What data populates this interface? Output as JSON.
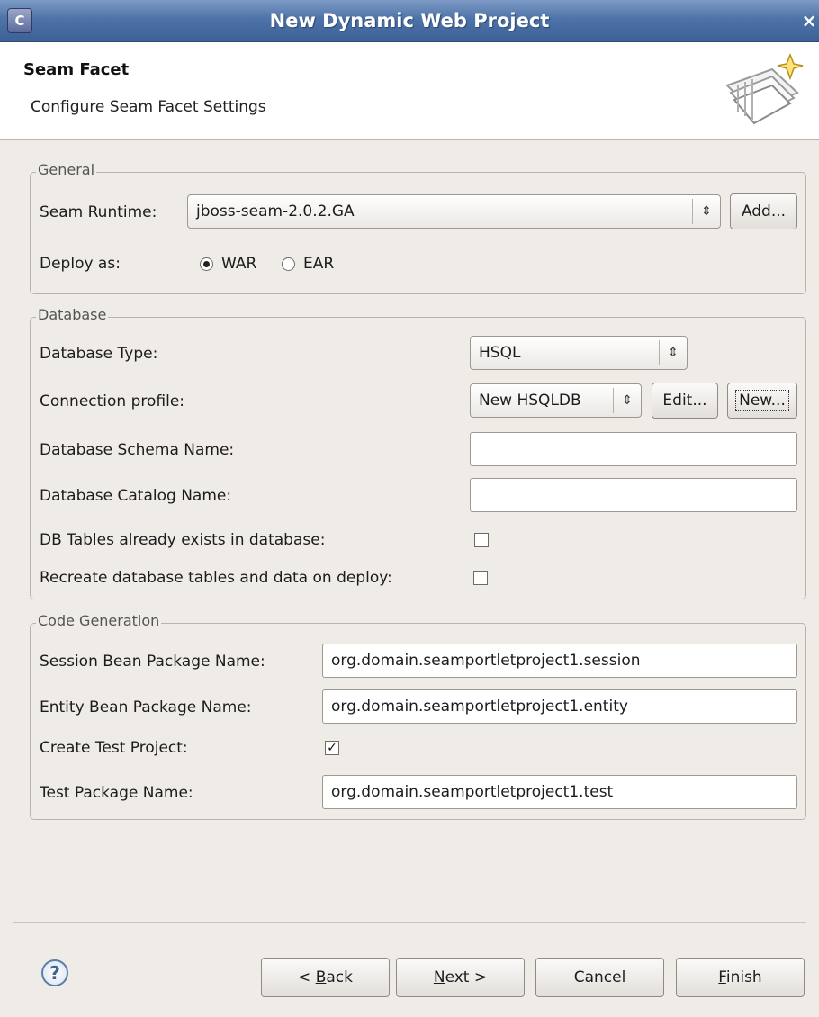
{
  "window": {
    "title": "New Dynamic Web Project",
    "close_glyph": "×",
    "app_icon_letter": "C"
  },
  "header": {
    "title": "Seam Facet",
    "description": "Configure Seam Facet Settings"
  },
  "general": {
    "legend": "General",
    "seam_runtime_label": "Seam Runtime:",
    "seam_runtime_value": "jboss-seam-2.0.2.GA",
    "add_button": "Add...",
    "deploy_as_label": "Deploy as:",
    "deploy_options": [
      {
        "label": "WAR",
        "selected": true
      },
      {
        "label": "EAR",
        "selected": false
      }
    ]
  },
  "database": {
    "legend": "Database",
    "type_label": "Database Type:",
    "type_value": "HSQL",
    "connection_label": "Connection profile:",
    "connection_value": "New HSQLDB",
    "edit_button": "Edit...",
    "new_button": "New...",
    "schema_label": "Database Schema Name:",
    "schema_value": "",
    "catalog_label": "Database Catalog Name:",
    "catalog_value": "",
    "tables_exist_label": "DB Tables already exists in database:",
    "tables_exist_checked": false,
    "recreate_label": "Recreate database tables and data on deploy:",
    "recreate_checked": false
  },
  "code_generation": {
    "legend": "Code Generation",
    "session_label": "Session Bean Package Name:",
    "session_value": "org.domain.seamportletproject1.session",
    "entity_label": "Entity Bean Package Name:",
    "entity_value": "org.domain.seamportletproject1.entity",
    "create_test_label": "Create Test Project:",
    "create_test_checked": true,
    "test_package_label": "Test Package Name:",
    "test_package_value": "org.domain.seamportletproject1.test"
  },
  "footer": {
    "help_glyph": "?",
    "back_prefix": "< ",
    "back_mnemonic": "B",
    "back_rest": "ack",
    "next_mnemonic": "N",
    "next_rest": "ext >",
    "cancel": "Cancel",
    "finish_mnemonic": "F",
    "finish_rest": "inish"
  },
  "colors": {
    "titlebar": "#4e73a8",
    "dialog_bg": "#efebe7",
    "help_icon": "#3f6690"
  }
}
